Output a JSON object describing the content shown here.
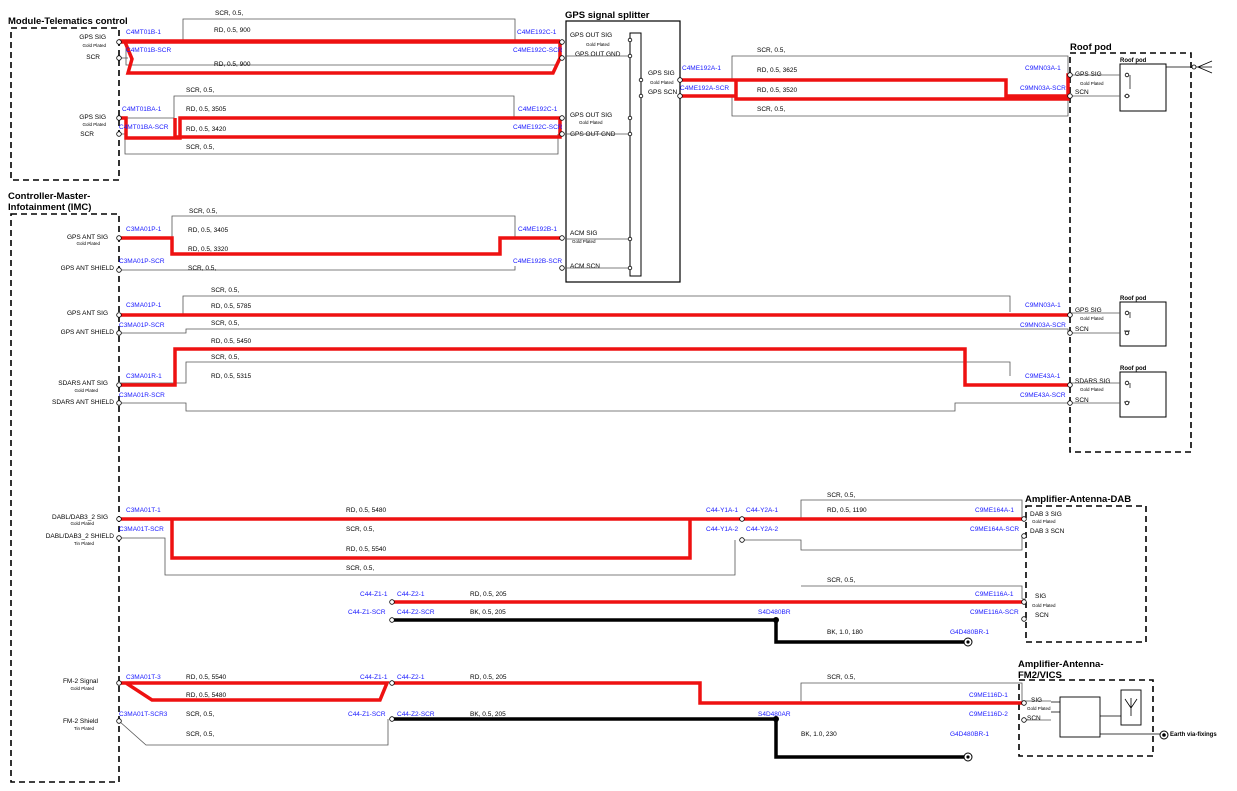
{
  "colors": {
    "signal": "#ee1111",
    "ground": "#000000",
    "connector_text": "#1a1aff"
  },
  "modules": {
    "telematics": {
      "title": "Module-Telematics control",
      "pins": [
        {
          "label": "GPS SIG",
          "sub": "Gold Plated"
        },
        {
          "label": "SCR"
        },
        {
          "label": "GPS SIG",
          "sub": "Gold Plated"
        },
        {
          "label": "SCR"
        }
      ]
    },
    "imc": {
      "title_line1": "Controller-Master-",
      "title_line2": "Infotainment (IMC)",
      "pins": [
        {
          "label": "GPS ANT SIG",
          "sub": "Gold Plated"
        },
        {
          "label": "GPS ANT SHIELD"
        },
        {
          "label": "GPS ANT SIG"
        },
        {
          "label": "GPS ANT SHIELD"
        },
        {
          "label": "SDARS ANT SIG",
          "sub": "Gold Plated"
        },
        {
          "label": "SDARS ANT SHIELD"
        },
        {
          "label": "DABL/DAB3_2 SIG",
          "sub": "Gold Plated"
        },
        {
          "label": "DABL/DAB3_2 SHIELD",
          "sub": "Tin Plated"
        },
        {
          "label": "FM-2 Signal",
          "sub": "Gold Plated"
        },
        {
          "label": "FM-2 Shield",
          "sub": "Tin Plated"
        }
      ]
    },
    "splitter": {
      "title": "GPS signal splitter",
      "pins": [
        {
          "label": "GPS OUT SIG",
          "sub": "Gold Plated"
        },
        {
          "label": "GPS OUT GND"
        },
        {
          "label": "GPS OUT SIG",
          "sub": "Gold Plated"
        },
        {
          "label": "GPS OUT GND"
        },
        {
          "label": "ACM SIG",
          "sub": "Gold Plated"
        },
        {
          "label": "ACM SCN"
        },
        {
          "label": "GPS SIG",
          "sub": "Gold Plated"
        },
        {
          "label": "GPS SCN"
        }
      ]
    },
    "roof": {
      "title": "Roof pod",
      "pod_label": "Roof pod",
      "pods": [
        {
          "sig": "GPS SIG",
          "sub": "Gold Plated",
          "scn": "SCN"
        },
        {
          "sig": "GPS SIG",
          "sub": "Gold Plated",
          "scn": "SCN"
        },
        {
          "sig": "SDARS SIG",
          "sub": "Gold Plated",
          "scn": "SCN"
        }
      ]
    },
    "dab": {
      "title": "Amplifier-Antenna-DAB",
      "pins": [
        {
          "label": "DAB 3 SIG",
          "sub": "Gold Plated"
        },
        {
          "label": "DAB 3 SCN"
        },
        {
          "label": "SIG",
          "sub": "Gold Plated"
        },
        {
          "label": "SCN"
        }
      ]
    },
    "fm2": {
      "title_line1": "Amplifier-Antenna-",
      "title_line2": "FM2/VICS",
      "pins": [
        {
          "label": "SIG",
          "sub": "Gold Plated"
        },
        {
          "label": "SCN"
        }
      ],
      "earth": "Earth via-fixings"
    }
  },
  "connectors": [
    "C4MT01B-1",
    "C4MT01B-SCR",
    "C4ME192C-1",
    "C4ME192C-SCR",
    "C4MT01BA-1",
    "C4MT01BA-SCR",
    "C4ME192C-1",
    "C4ME192C-SCR",
    "C4ME192A-1",
    "C4ME192A-SCR",
    "C9MN03A-1",
    "C9MN03A-SCR",
    "C3MA01P-1",
    "C3MA01P-SCR",
    "C4ME192B-1",
    "C4ME192B-SCR",
    "C3MA01P-1",
    "C3MA01P-SCR",
    "C9MN03A-1",
    "C9MN03A-SCR",
    "C3MA01R-1",
    "C3MA01R-SCR",
    "C9ME43A-1",
    "C9ME43A-SCR",
    "C3MA01T-1",
    "C3MA01T-SCR",
    "C44-Y1A-1",
    "C44-Y2A-1",
    "C44-Y1A-2",
    "C44-Y2A-2",
    "C9ME164A-1",
    "C9ME164A-SCR",
    "C44-Z1-1",
    "C44-Z2-1",
    "C44-Z1-SCR",
    "C44-Z2-SCR",
    "S4D480BR",
    "C9ME116A-1",
    "C9ME116A-SCR",
    "G4D480BR-1",
    "C3MA01T-3",
    "C44-Z1-1",
    "C44-Z2-1",
    "C3MA01T-SCR3",
    "C44-Z1-SCR",
    "C44-Z2-SCR",
    "S4D480AR",
    "C9ME116D-1",
    "C9ME116D-2",
    "G4D480BR-1"
  ],
  "wires": [
    "SCR, 0.5,",
    "RD, 0.5, 900",
    "RD, 0.5, 900",
    "SCR, 0.5,",
    "RD, 0.5, 3505",
    "RD, 0.5, 3420",
    "SCR, 0.5,",
    "SCR, 0.5,",
    "RD, 0.5, 3625",
    "RD, 0.5, 3520",
    "SCR, 0.5,",
    "SCR, 0.5,",
    "RD, 0.5, 3405",
    "RD, 0.5, 3320",
    "SCR, 0.5,",
    "SCR, 0.5,",
    "RD, 0.5, 5785",
    "SCR, 0.5,",
    "RD, 0.5, 5450",
    "SCR, 0.5,",
    "RD, 0.5, 5315",
    "RD, 0.5, 5480",
    "SCR, 0.5,",
    "RD, 0.5, 5540",
    "SCR, 0.5,",
    "SCR, 0.5,",
    "RD, 0.5, 1190",
    "RD, 0.5, 205",
    "BK, 0.5, 205",
    "SCR, 0.5,",
    "BK, 1.0, 180",
    "RD, 0.5, 5540",
    "RD, 0.5, 5480",
    "SCR, 0.5,",
    "SCR, 0.5,",
    "RD, 0.5, 205",
    "BK, 0.5, 205",
    "SCR, 0.5,",
    "BK, 1.0, 230"
  ]
}
